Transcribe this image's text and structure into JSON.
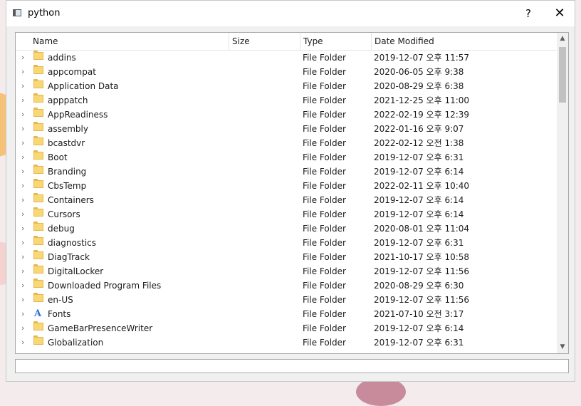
{
  "window": {
    "title": "python",
    "help_label": "?",
    "close_label": "✕"
  },
  "columns": [
    "Name",
    "Size",
    "Type",
    "Date Modified"
  ],
  "rows": [
    {
      "name": "addins",
      "type": "File Folder",
      "date": "2019-12-07 오후 11:57",
      "icon": "folder-icon"
    },
    {
      "name": "appcompat",
      "type": "File Folder",
      "date": "2020-06-05 오후 9:38",
      "icon": "folder-icon"
    },
    {
      "name": "Application Data",
      "type": "File Folder",
      "date": "2020-08-29 오후 6:38",
      "icon": "folder-icon"
    },
    {
      "name": "apppatch",
      "type": "File Folder",
      "date": "2021-12-25 오후 11:00",
      "icon": "folder-icon"
    },
    {
      "name": "AppReadiness",
      "type": "File Folder",
      "date": "2022-02-19 오후 12:39",
      "icon": "folder-icon"
    },
    {
      "name": "assembly",
      "type": "File Folder",
      "date": "2022-01-16 오후 9:07",
      "icon": "folder-icon"
    },
    {
      "name": "bcastdvr",
      "type": "File Folder",
      "date": "2022-02-12 오전 1:38",
      "icon": "folder-icon"
    },
    {
      "name": "Boot",
      "type": "File Folder",
      "date": "2019-12-07 오후 6:31",
      "icon": "folder-icon"
    },
    {
      "name": "Branding",
      "type": "File Folder",
      "date": "2019-12-07 오후 6:14",
      "icon": "folder-icon"
    },
    {
      "name": "CbsTemp",
      "type": "File Folder",
      "date": "2022-02-11 오후 10:40",
      "icon": "folder-icon"
    },
    {
      "name": "Containers",
      "type": "File Folder",
      "date": "2019-12-07 오후 6:14",
      "icon": "folder-icon"
    },
    {
      "name": "Cursors",
      "type": "File Folder",
      "date": "2019-12-07 오후 6:14",
      "icon": "folder-icon"
    },
    {
      "name": "debug",
      "type": "File Folder",
      "date": "2020-08-01 오후 11:04",
      "icon": "folder-icon"
    },
    {
      "name": "diagnostics",
      "type": "File Folder",
      "date": "2019-12-07 오후 6:31",
      "icon": "folder-icon"
    },
    {
      "name": "DiagTrack",
      "type": "File Folder",
      "date": "2021-10-17 오후 10:58",
      "icon": "folder-icon"
    },
    {
      "name": "DigitalLocker",
      "type": "File Folder",
      "date": "2019-12-07 오후 11:56",
      "icon": "folder-icon"
    },
    {
      "name": "Downloaded Program Files",
      "type": "File Folder",
      "date": "2020-08-29 오후 6:30",
      "icon": "folder-icon"
    },
    {
      "name": "en-US",
      "type": "File Folder",
      "date": "2019-12-07 오후 11:56",
      "icon": "folder-icon"
    },
    {
      "name": "Fonts",
      "type": "File Folder",
      "date": "2021-07-10 오전 3:17",
      "icon": "fonts-folder-icon"
    },
    {
      "name": "GameBarPresenceWriter",
      "type": "File Folder",
      "date": "2019-12-07 오후 6:14",
      "icon": "folder-icon"
    },
    {
      "name": "Globalization",
      "type": "File Folder",
      "date": "2019-12-07 오후 6:31",
      "icon": "folder-icon"
    }
  ],
  "status_text": ""
}
